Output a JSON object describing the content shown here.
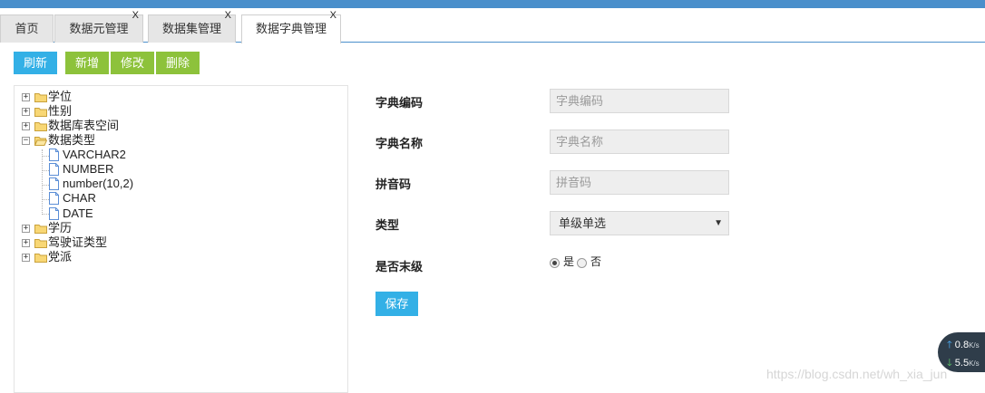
{
  "tabs": [
    {
      "label": "首页"
    },
    {
      "label": "数据元管理",
      "close": "X"
    },
    {
      "label": "数据集管理",
      "close": "X"
    },
    {
      "label": "数据字典管理",
      "close": "X"
    }
  ],
  "toolbar": {
    "refresh": "刷新",
    "add": "新增",
    "edit": "修改",
    "delete": "删除"
  },
  "tree": {
    "nodes": [
      {
        "label": "学位",
        "toggle": "+"
      },
      {
        "label": "性别",
        "toggle": "+"
      },
      {
        "label": "数据库表空间",
        "toggle": "+"
      },
      {
        "label": "数据类型",
        "toggle": "−"
      },
      {
        "label": "学历",
        "toggle": "+"
      },
      {
        "label": "驾驶证类型",
        "toggle": "+"
      },
      {
        "label": "党派",
        "toggle": "+"
      }
    ],
    "children": [
      "VARCHAR2",
      "NUMBER",
      "number(10,2)",
      "CHAR",
      "DATE"
    ]
  },
  "form": {
    "code_label": "字典编码",
    "code_placeholder": "字典编码",
    "name_label": "字典名称",
    "name_placeholder": "字典名称",
    "pinyin_label": "拼音码",
    "pinyin_placeholder": "拼音码",
    "type_label": "类型",
    "type_value": "单级单选",
    "leaf_label": "是否末级",
    "yes": "是",
    "no": "否",
    "save": "保存"
  },
  "speed": {
    "up": "0.8",
    "down": "5.5",
    "unit": "K/s"
  },
  "watermark": "https://blog.csdn.net/wh_xia_jun"
}
